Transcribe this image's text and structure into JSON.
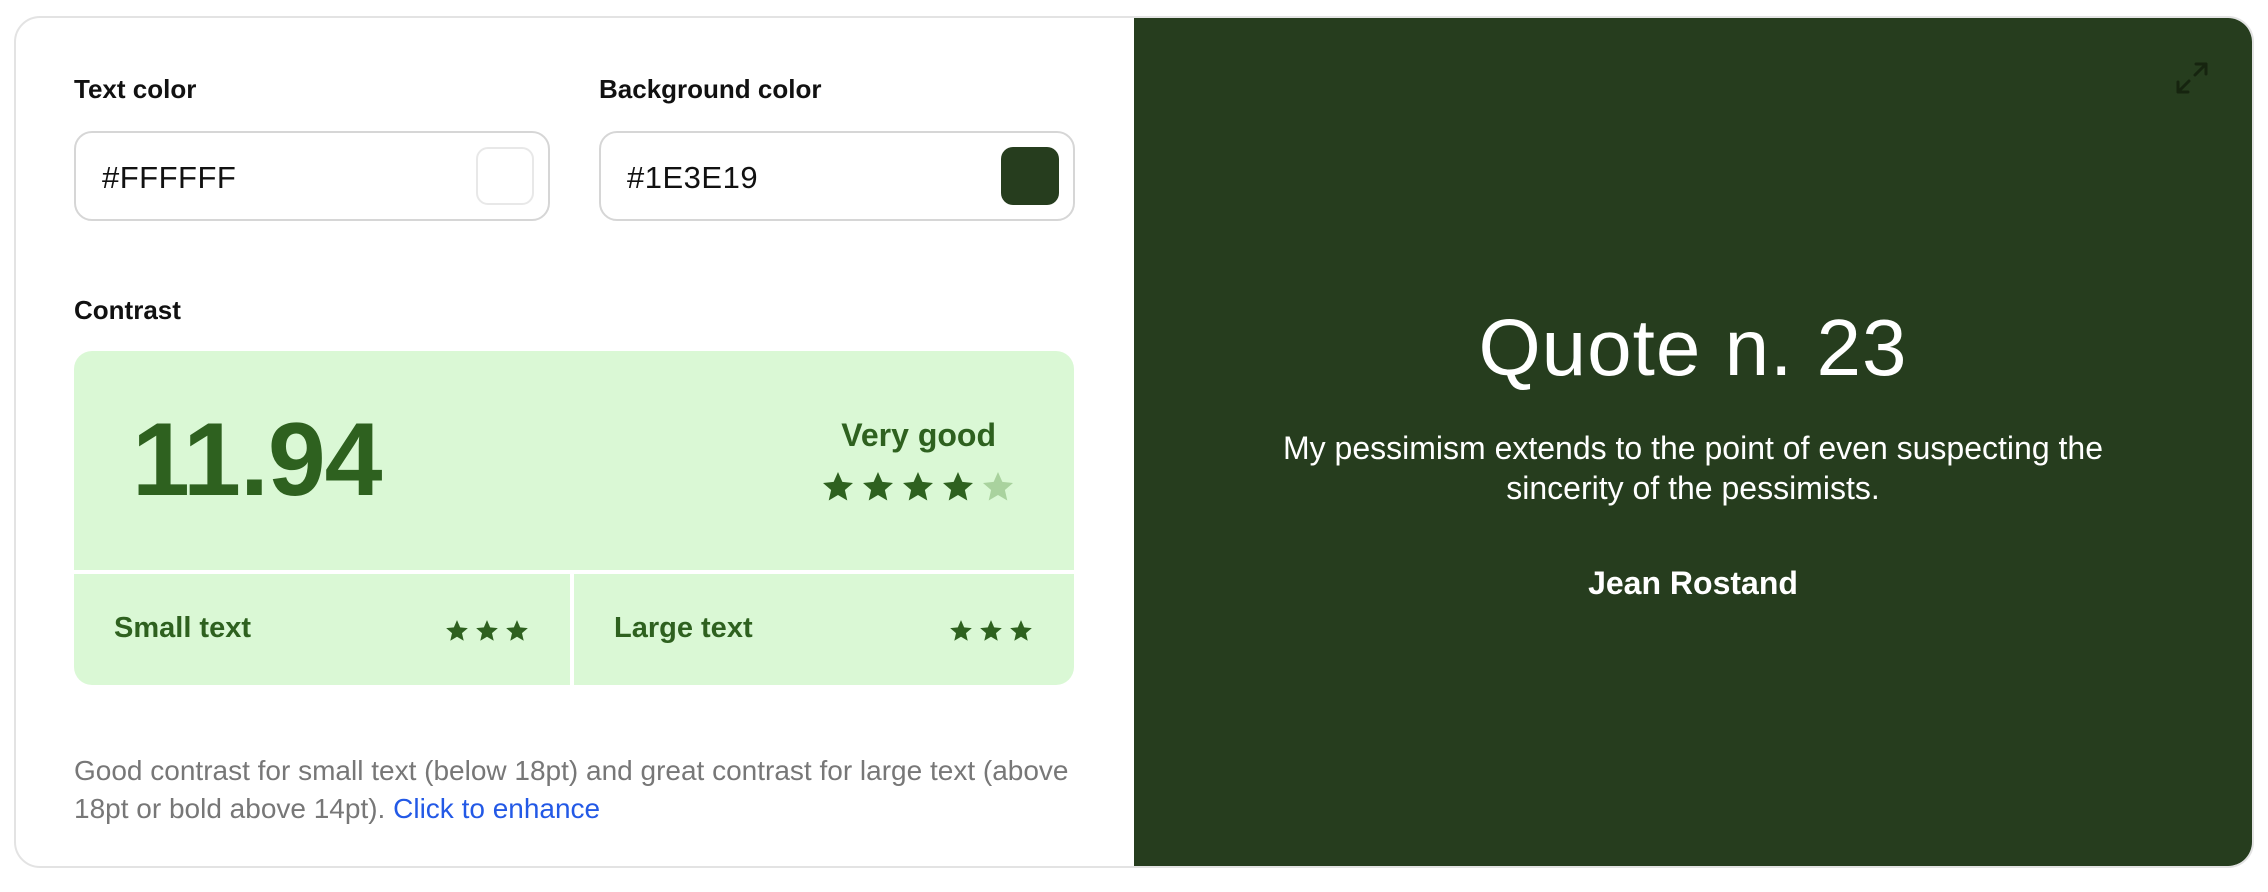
{
  "text_color": {
    "label": "Text color",
    "value": "#FFFFFF",
    "swatch": "#FFFFFF"
  },
  "background_color": {
    "label": "Background color",
    "value": "#1E3E19",
    "swatch": "#263D1E"
  },
  "contrast": {
    "label": "Contrast",
    "ratio": "11.94",
    "rating": "Very good",
    "stars_filled": 4,
    "stars_total": 5,
    "small_text": {
      "label": "Small text",
      "stars": 3
    },
    "large_text": {
      "label": "Large text",
      "stars": 3
    },
    "description": "Good contrast for small text (below 18pt) and great contrast for large text (above 18pt or bold above 14pt).",
    "enhance_link": "Click to enhance"
  },
  "preview": {
    "expand_icon": "expand-icon",
    "title": "Quote n. 23",
    "quote": "My pessimism extends to the point of even suspecting the sincerity of the pessimists.",
    "author": "Jean Rostand"
  },
  "colors": {
    "panel_bg": "#DAF8D5",
    "accent": "#2E611F",
    "star_empty": "#A9D29E",
    "link": "#2359E6"
  }
}
